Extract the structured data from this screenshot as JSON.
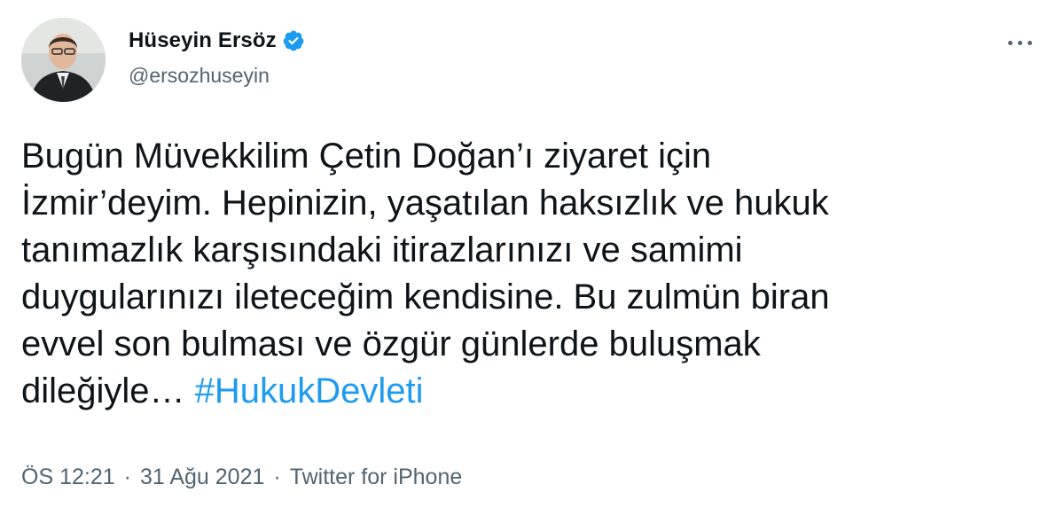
{
  "author": {
    "display_name": "Hüseyin Ersöz",
    "handle": "@ersozhuseyin",
    "verified": true
  },
  "tweet": {
    "text": "Bugün Müvekkilim Çetin Doğan’ı ziyaret için\nİzmir’deyim. Hepinizin, yaşatılan haksızlık ve hukuk\ntanımazlık karşısındaki itirazlarınızı ve samimi\nduygularınızı ileteceğim kendisine. Bu zulmün biran\nevvel son bulması ve özgür günlerde buluşmak\ndileğiyle… ",
    "hashtag": "#HukukDevleti"
  },
  "meta": {
    "time": "ÖS 12:21",
    "separator": "·",
    "date": "31 Ağu 2021",
    "source": "Twitter for iPhone"
  },
  "colors": {
    "link": "#1d9bf0",
    "secondary_text": "#536471",
    "primary_text": "#0f1419"
  },
  "icons": {
    "verified": "verified-badge-icon",
    "more": "more-options-icon"
  }
}
